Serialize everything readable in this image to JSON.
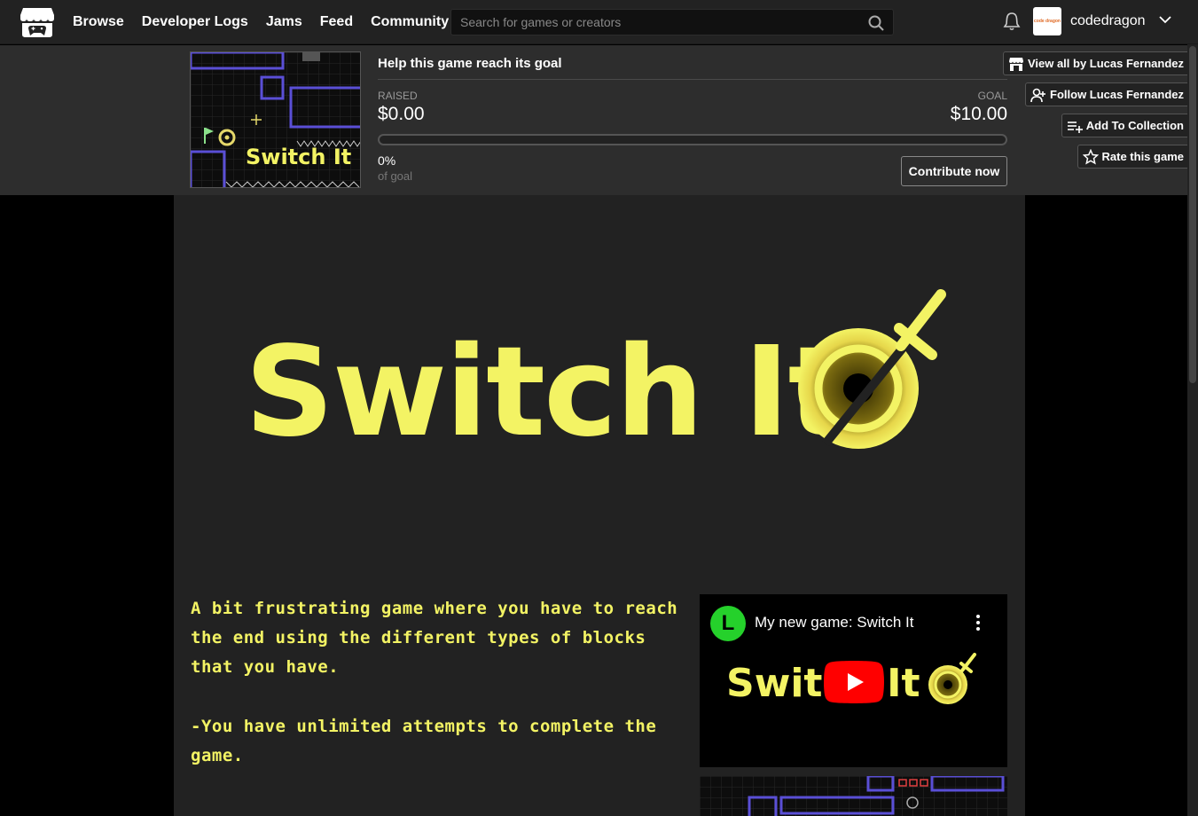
{
  "nav": {
    "logo": "itchio-logo-icon",
    "links": [
      "Browse",
      "Developer Logs",
      "Jams",
      "Feed",
      "Community"
    ],
    "search_placeholder": "Search for games or creators",
    "username": "codedragon",
    "avatar_text": "code dragon"
  },
  "fundraiser": {
    "title": "Help this game reach its goal",
    "raised_label": "RAISED",
    "raised_value": "$0.00",
    "goal_label": "GOAL",
    "goal_value": "$10.00",
    "percent": "0%",
    "percent_value": 0,
    "of_goal": "of goal",
    "contribute_label": "Contribute now",
    "thumbnail_title": "Switch It"
  },
  "side_buttons": {
    "view_all": "View all by Lucas Fernandez",
    "follow": "Follow Lucas Fernandez",
    "add_collection": "Add To Collection",
    "rate": "Rate this game"
  },
  "game": {
    "banner_title": "Switch It",
    "description": [
      "A bit frustrating game where you have to reach the end using the different types of blocks that you have.",
      "-You have unlimited attempts to complete the game."
    ],
    "video": {
      "channel_letter": "L",
      "title": "My new game: Switch It",
      "thumb_title": "Switch It"
    }
  },
  "colors": {
    "accent_yellow": "#f3f364",
    "page_bg": "#222222",
    "fund_bg": "#2d2d2d",
    "youtube_red": "#ff0000",
    "channel_green": "#25d12b"
  }
}
